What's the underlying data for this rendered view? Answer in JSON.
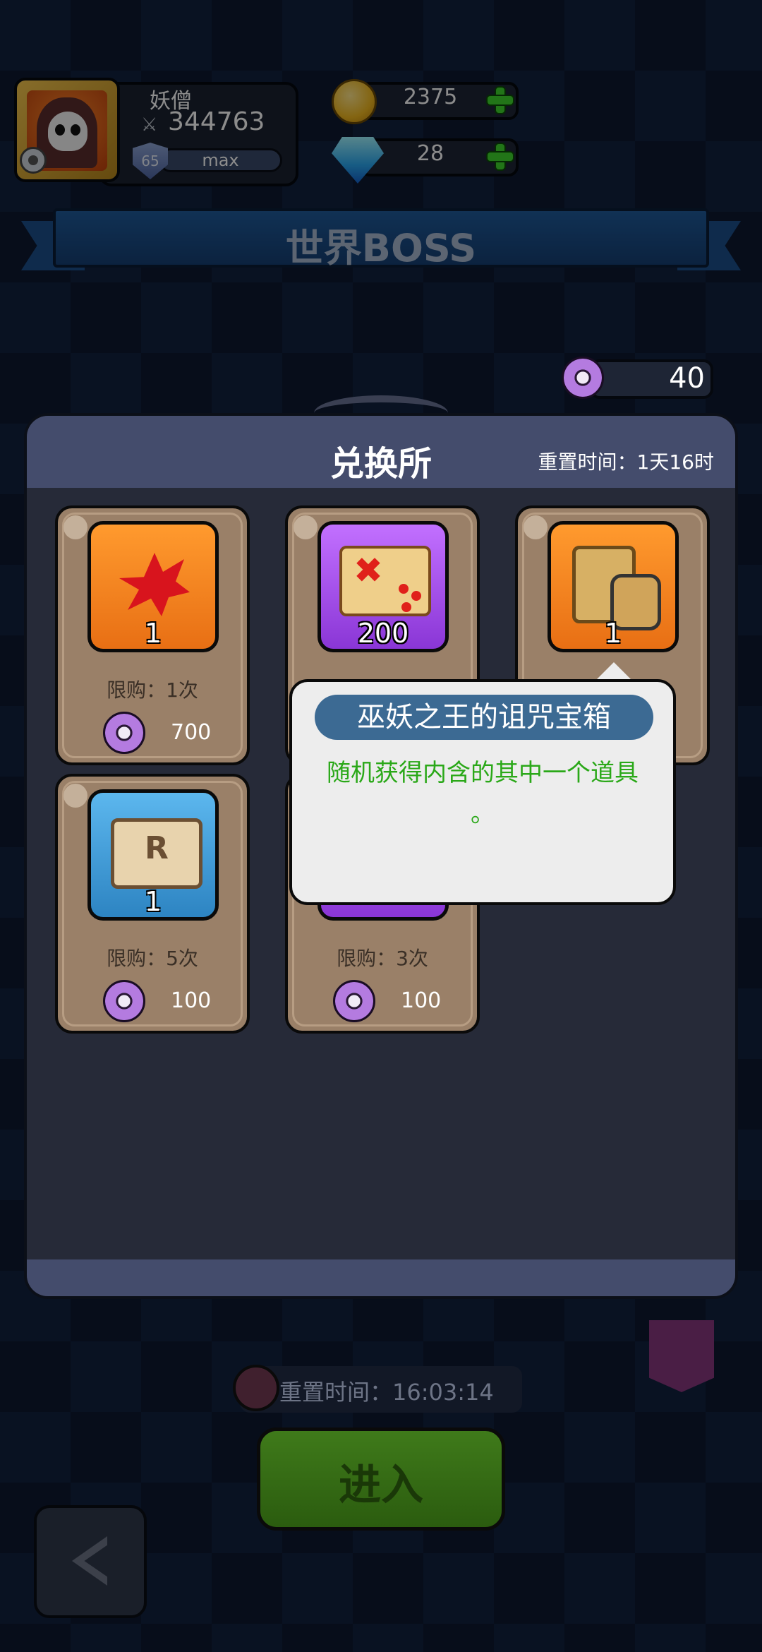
{
  "player": {
    "name": "妖僧",
    "power": "344763",
    "level": "65",
    "exp_label": "max"
  },
  "currency": {
    "gold": "2375",
    "diamond": "28"
  },
  "banner": {
    "title": "世界BOSS"
  },
  "token_balance": "40",
  "shop": {
    "title": "兑换所",
    "reset_time": "重置时间：1天16时",
    "items": [
      {
        "icon": "red-crystal-icon",
        "qty": "1",
        "limit": "限购：1次",
        "price": "700",
        "bg": "orange"
      },
      {
        "icon": "treasure-map-icon",
        "qty": "200",
        "limit": "",
        "price": "",
        "bg": "purple"
      },
      {
        "icon": "cursed-chest-icon",
        "qty": "1",
        "limit": "",
        "price": "",
        "bg": "orange"
      },
      {
        "icon": "refresh-ticket-icon",
        "qty": "1",
        "limit": "限购：5次",
        "price": "100",
        "bg": "blue"
      },
      {
        "icon": "purple-item-icon",
        "qty": "",
        "limit": "限购：3次",
        "price": "100",
        "bg": "purple"
      }
    ]
  },
  "tooltip": {
    "title": "巫妖之王的诅咒宝箱",
    "description": "随机获得内含的其中一个道具",
    "period": "。"
  },
  "boss_timer": "重置时间：16:03:14",
  "enter_label": "进入"
}
